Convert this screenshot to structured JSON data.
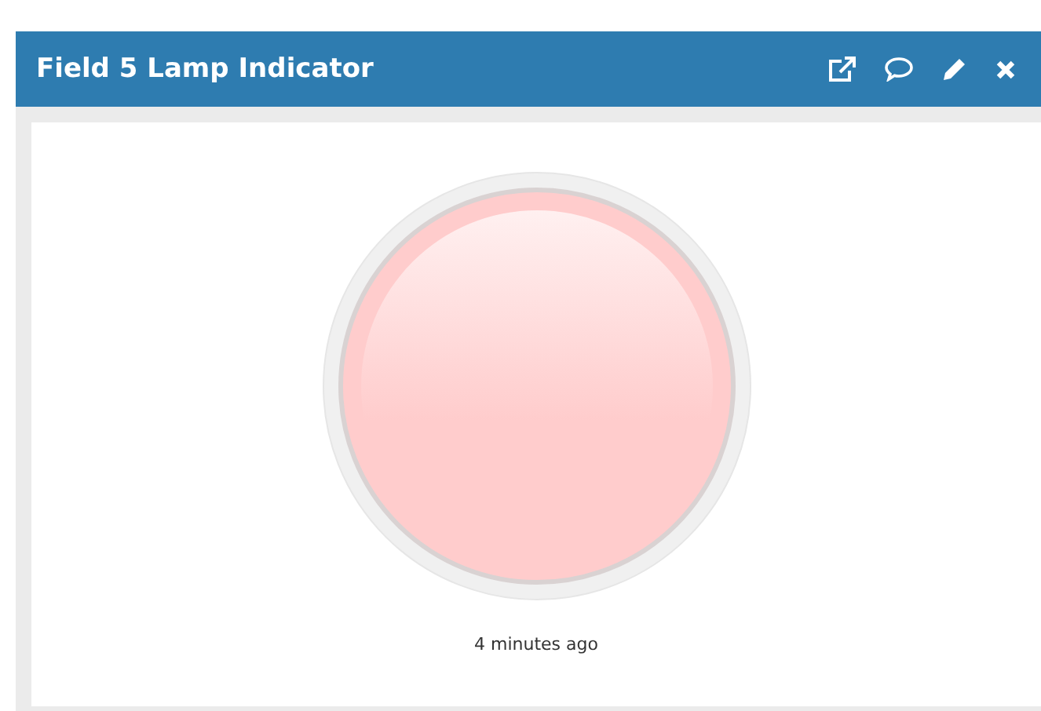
{
  "widget": {
    "title": "Field 5 Lamp Indicator",
    "actions": [
      {
        "kind": "popout"
      },
      {
        "kind": "comment"
      },
      {
        "kind": "edit"
      },
      {
        "kind": "close"
      }
    ],
    "lamp": {
      "on": false
    },
    "timestamp": "4 minutes ago"
  }
}
